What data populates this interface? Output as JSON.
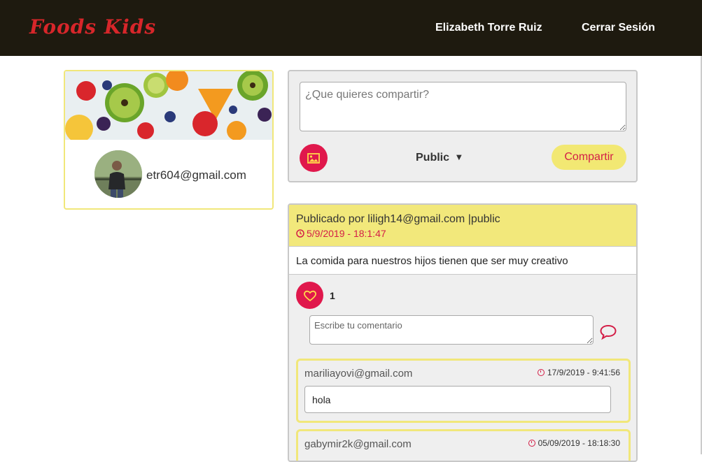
{
  "header": {
    "brand": "Foods Kids",
    "user_name": "Elizabeth Torre Ruiz",
    "logout_label": "Cerrar Sesión"
  },
  "profile": {
    "email": "etr604@gmail.com"
  },
  "composer": {
    "placeholder": "¿Que quieres compartir?",
    "privacy": "Public",
    "share_label": "Compartir",
    "image_icon": "image-icon"
  },
  "post": {
    "author_line": "Publicado por liligh14@gmail.com |public",
    "timestamp": "5/9/2019 - 18:1:47",
    "text": "La comida para nuestros hijos tienen que ser muy creativo",
    "likes": "1",
    "comment_placeholder": "Escribe tu comentario",
    "comments": [
      {
        "author": "mariliayovi@gmail.com",
        "timestamp": "17/9/2019 - 9:41:56",
        "text": "hola"
      },
      {
        "author": "gabymir2k@gmail.com",
        "timestamp": "05/09/2019 - 18:18:30",
        "text": ""
      }
    ]
  },
  "colors": {
    "navbar": "#1e1a0f",
    "brand": "#d7262a",
    "accent": "#e0184c",
    "highlight": "#f2e87b"
  }
}
